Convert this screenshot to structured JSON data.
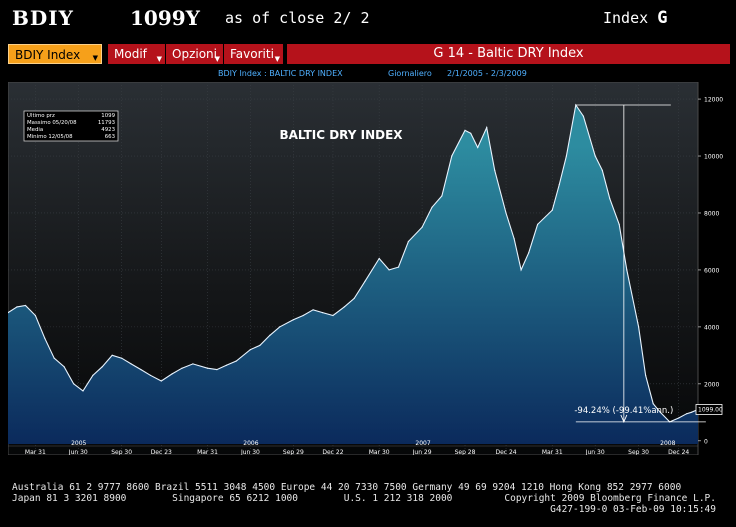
{
  "header": {
    "ticker": "BDIY",
    "price": "1099Y",
    "as_of": "as of close  2/ 2",
    "index_label": "Index",
    "index_key": "G"
  },
  "toolbar": {
    "security_button": "BDIY Index",
    "menus": [
      "Modif",
      "Opzioni",
      "Favoriti"
    ],
    "graph_title": "G 14 - Baltic DRY Index"
  },
  "subtitle": {
    "security": "BDIY Index : BALTIC DRY INDEX",
    "frequency": "Giornaliero",
    "range": "2/1/2005 - 2/3/2009"
  },
  "stats_box": {
    "rows": [
      {
        "label": "Ultimo prz",
        "value": "1099"
      },
      {
        "label": "Massimo 05/20/08",
        "value": "11793"
      },
      {
        "label": "Media",
        "value": "4923"
      },
      {
        "label": "Minimo 12/05/08",
        "value": "663"
      }
    ]
  },
  "annotation": {
    "change": "-94.24% (-99.41%ann.)",
    "last_price_tag": "1099.00"
  },
  "colors": {
    "area_top": "#2d8ca0",
    "area_bottom": "#0b2a5c",
    "toolbar_red": "#b5121b",
    "security_orange": "#f6a01a",
    "subtitle_blue": "#4fb0ff"
  },
  "chart_data": {
    "type": "area",
    "title": "BALTIC DRY INDEX",
    "xlabel": "",
    "ylabel": "",
    "xlim": [
      "2005-02-01",
      "2009-02-03"
    ],
    "ylim": [
      -500,
      12600
    ],
    "y_ticks": [
      0,
      2000,
      4000,
      6000,
      8000,
      10000,
      12000
    ],
    "x_ticks": [
      {
        "label": "Mar 31",
        "date": "2005-03-31"
      },
      {
        "label": "Jun 30",
        "date": "2005-06-30"
      },
      {
        "label": "Sep 30",
        "date": "2005-09-30"
      },
      {
        "label": "Dec 23",
        "date": "2005-12-23"
      },
      {
        "label": "Mar 31",
        "date": "2006-03-31"
      },
      {
        "label": "Jun 30",
        "date": "2006-06-30"
      },
      {
        "label": "Sep 29",
        "date": "2006-09-29"
      },
      {
        "label": "Dec 22",
        "date": "2006-12-22"
      },
      {
        "label": "Mar 30",
        "date": "2007-03-30"
      },
      {
        "label": "Jun 29",
        "date": "2007-06-29"
      },
      {
        "label": "Sep 28",
        "date": "2007-09-28"
      },
      {
        "label": "Dec 24",
        "date": "2007-12-24"
      },
      {
        "label": "Mar 31",
        "date": "2008-03-31"
      },
      {
        "label": "Jun 30",
        "date": "2008-06-30"
      },
      {
        "label": "Sep 30",
        "date": "2008-09-30"
      },
      {
        "label": "Dec 24",
        "date": "2008-12-24"
      }
    ],
    "year_labels": [
      {
        "label": "2005",
        "date": "2005-07-01"
      },
      {
        "label": "2006",
        "date": "2006-07-01"
      },
      {
        "label": "2007",
        "date": "2007-07-01"
      },
      {
        "label": "2008",
        "date": "2008-12-01"
      }
    ],
    "series": [
      {
        "x": [
          "2005-02-01",
          "2005-02-20",
          "2005-03-10",
          "2005-03-31",
          "2005-04-20",
          "2005-05-10",
          "2005-05-31",
          "2005-06-20",
          "2005-07-10",
          "2005-07-31",
          "2005-08-20",
          "2005-09-10",
          "2005-09-30",
          "2005-10-20",
          "2005-11-10",
          "2005-11-30",
          "2005-12-23",
          "2006-01-15",
          "2006-02-05",
          "2006-02-28",
          "2006-03-31",
          "2006-04-20",
          "2006-05-10",
          "2006-05-31",
          "2006-06-30",
          "2006-07-20",
          "2006-08-10",
          "2006-08-31",
          "2006-09-29",
          "2006-10-20",
          "2006-11-10",
          "2006-11-30",
          "2006-12-22",
          "2007-01-15",
          "2007-02-05",
          "2007-02-28",
          "2007-03-30",
          "2007-04-20",
          "2007-05-10",
          "2007-05-31",
          "2007-06-29",
          "2007-07-20",
          "2007-08-10",
          "2007-08-31",
          "2007-09-28",
          "2007-10-10",
          "2007-10-25",
          "2007-11-13",
          "2007-11-30",
          "2007-12-24",
          "2008-01-10",
          "2008-01-25",
          "2008-02-10",
          "2008-02-29",
          "2008-03-31",
          "2008-04-15",
          "2008-04-30",
          "2008-05-20",
          "2008-06-05",
          "2008-06-30",
          "2008-07-15",
          "2008-07-31",
          "2008-08-20",
          "2008-09-05",
          "2008-09-30",
          "2008-10-15",
          "2008-10-31",
          "2008-11-15",
          "2008-12-05",
          "2008-12-24",
          "2009-01-10",
          "2009-01-20",
          "2009-02-03"
        ],
        "values": [
          4500,
          4700,
          4750,
          4400,
          3600,
          2900,
          2600,
          2000,
          1750,
          2300,
          2600,
          3000,
          2900,
          2700,
          2500,
          2300,
          2100,
          2350,
          2550,
          2700,
          2550,
          2500,
          2650,
          2800,
          3200,
          3350,
          3700,
          4000,
          4250,
          4400,
          4600,
          4500,
          4400,
          4700,
          5000,
          5600,
          6400,
          6000,
          6100,
          7000,
          7500,
          8200,
          8600,
          10000,
          10900,
          10800,
          10300,
          11000,
          9500,
          8000,
          7100,
          6000,
          6600,
          7600,
          8100,
          9000,
          10000,
          11793,
          11400,
          10000,
          9500,
          8500,
          7600,
          6000,
          4000,
          2300,
          1300,
          1000,
          663,
          800,
          950,
          1000,
          1099
        ]
      }
    ]
  },
  "footer": {
    "line1": "Australia 61 2 9777 8600 Brazil 5511 3048 4500 Europe 44 20 7330 7500 Germany 49 69 9204 1210 Hong Kong 852 2977 6000",
    "line2": "Japan 81 3 3201 8900        Singapore 65 6212 1000        U.S. 1 212 318 2000",
    "copyright": "Copyright 2009 Bloomberg Finance L.P.",
    "stamp": "G427-199-0 03-Feb-09 10:15:49"
  }
}
